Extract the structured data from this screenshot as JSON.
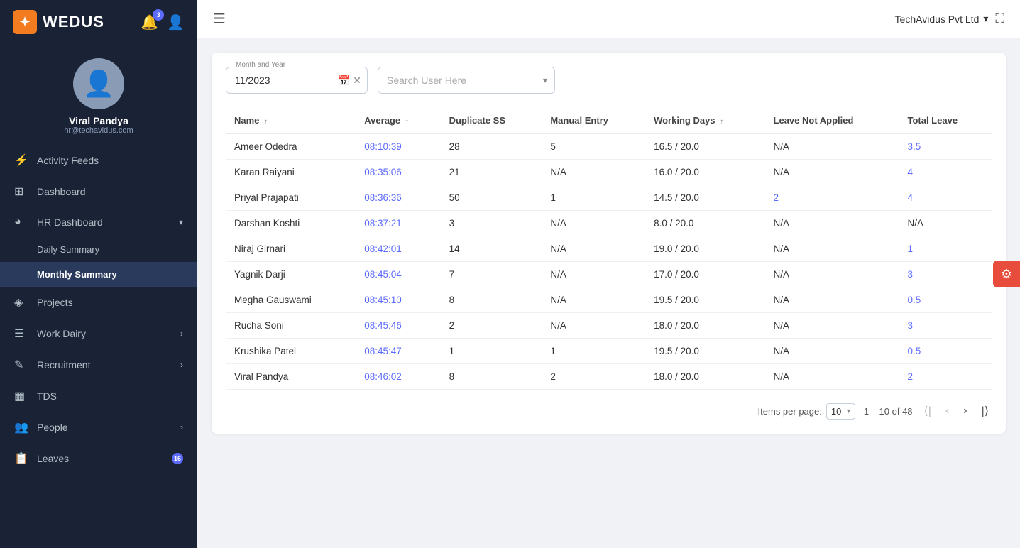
{
  "app": {
    "name": "WEDUS",
    "logo_char": "✦",
    "notif_count": "3",
    "company": "TechAvidus Pvt Ltd"
  },
  "user": {
    "name": "Viral Pandya",
    "email": "hr@techavidus.com"
  },
  "sidebar": {
    "items": [
      {
        "id": "activity-feeds",
        "label": "Activity Feeds",
        "icon": "⚡",
        "has_arrow": false
      },
      {
        "id": "dashboard",
        "label": "Dashboard",
        "icon": "⊞",
        "has_arrow": false
      },
      {
        "id": "hr-dashboard",
        "label": "HR Dashboard",
        "icon": "◕",
        "has_arrow": true
      },
      {
        "id": "daily-summary",
        "label": "Daily Summary",
        "sub": true
      },
      {
        "id": "monthly-summary",
        "label": "Monthly Summary",
        "sub": true,
        "active": true
      },
      {
        "id": "projects",
        "label": "Projects",
        "icon": "◈",
        "has_arrow": false
      },
      {
        "id": "work-dairy",
        "label": "Work Dairy",
        "icon": "☰",
        "has_arrow": true
      },
      {
        "id": "recruitment",
        "label": "Recruitment",
        "icon": "✎",
        "has_arrow": true
      },
      {
        "id": "tds",
        "label": "TDS",
        "icon": "▦",
        "has_arrow": false
      },
      {
        "id": "people",
        "label": "People",
        "icon": "👤",
        "has_arrow": true
      },
      {
        "id": "leaves",
        "label": "Leaves",
        "icon": "📋",
        "has_arrow": false,
        "badge": "16"
      }
    ]
  },
  "topbar": {
    "hamburger_label": "☰",
    "company": "TechAvidus Pvt Ltd",
    "fullscreen_icon": "⛶"
  },
  "filters": {
    "date_label": "Month and Year",
    "date_value": "11/2023",
    "search_placeholder": "Search User Here"
  },
  "table": {
    "columns": [
      {
        "id": "name",
        "label": "Name",
        "sortable": true
      },
      {
        "id": "average",
        "label": "Average",
        "sortable": true
      },
      {
        "id": "duplicate_ss",
        "label": "Duplicate SS",
        "sortable": false
      },
      {
        "id": "manual_entry",
        "label": "Manual Entry",
        "sortable": false
      },
      {
        "id": "working_days",
        "label": "Working Days",
        "sortable": true
      },
      {
        "id": "leave_not_applied",
        "label": "Leave Not Applied",
        "sortable": false
      },
      {
        "id": "total_leave",
        "label": "Total Leave",
        "sortable": false
      }
    ],
    "rows": [
      {
        "name": "Ameer Odedra",
        "average": "08:10:39",
        "average_link": true,
        "duplicate_ss": "28",
        "manual_entry": "5",
        "working_days": "16.5 / 20.0",
        "leave_not_applied": "N/A",
        "total_leave": "3.5",
        "total_link": true
      },
      {
        "name": "Karan Raiyani",
        "average": "08:35:06",
        "average_link": true,
        "duplicate_ss": "21",
        "manual_entry": "N/A",
        "working_days": "16.0 / 20.0",
        "leave_not_applied": "N/A",
        "total_leave": "4",
        "total_link": true
      },
      {
        "name": "Priyal Prajapati",
        "average": "08:36:36",
        "average_link": true,
        "duplicate_ss": "50",
        "manual_entry": "1",
        "working_days": "14.5 / 20.0",
        "leave_not_applied": "2",
        "leave_not_applied_link": true,
        "total_leave": "4",
        "total_link": true
      },
      {
        "name": "Darshan Koshti",
        "average": "08:37:21",
        "average_link": true,
        "duplicate_ss": "3",
        "manual_entry": "N/A",
        "working_days": "8.0 / 20.0",
        "leave_not_applied": "N/A",
        "total_leave": "N/A",
        "total_link": false
      },
      {
        "name": "Niraj Girnari",
        "average": "08:42:01",
        "average_link": true,
        "duplicate_ss": "14",
        "manual_entry": "N/A",
        "working_days": "19.0 / 20.0",
        "leave_not_applied": "N/A",
        "total_leave": "1",
        "total_link": true
      },
      {
        "name": "Yagnik Darji",
        "average": "08:45:04",
        "average_link": true,
        "duplicate_ss": "7",
        "manual_entry": "N/A",
        "working_days": "17.0 / 20.0",
        "leave_not_applied": "N/A",
        "total_leave": "3",
        "total_link": true
      },
      {
        "name": "Megha Gauswami",
        "average": "08:45:10",
        "average_link": true,
        "duplicate_ss": "8",
        "manual_entry": "N/A",
        "working_days": "19.5 / 20.0",
        "leave_not_applied": "N/A",
        "total_leave": "0.5",
        "total_link": true
      },
      {
        "name": "Rucha Soni",
        "average": "08:45:46",
        "average_link": true,
        "duplicate_ss": "2",
        "manual_entry": "N/A",
        "working_days": "18.0 / 20.0",
        "leave_not_applied": "N/A",
        "total_leave": "3",
        "total_link": true
      },
      {
        "name": "Krushika Patel",
        "average": "08:45:47",
        "average_link": true,
        "duplicate_ss": "1",
        "manual_entry": "1",
        "working_days": "19.5 / 20.0",
        "leave_not_applied": "N/A",
        "total_leave": "0.5",
        "total_link": true
      },
      {
        "name": "Viral Pandya",
        "average": "08:46:02",
        "average_link": true,
        "duplicate_ss": "8",
        "manual_entry": "2",
        "working_days": "18.0 / 20.0",
        "leave_not_applied": "N/A",
        "total_leave": "2",
        "total_link": true
      }
    ]
  },
  "pagination": {
    "items_per_page_label": "Items per page:",
    "per_page_value": "10",
    "page_info": "1 – 10 of 48"
  }
}
